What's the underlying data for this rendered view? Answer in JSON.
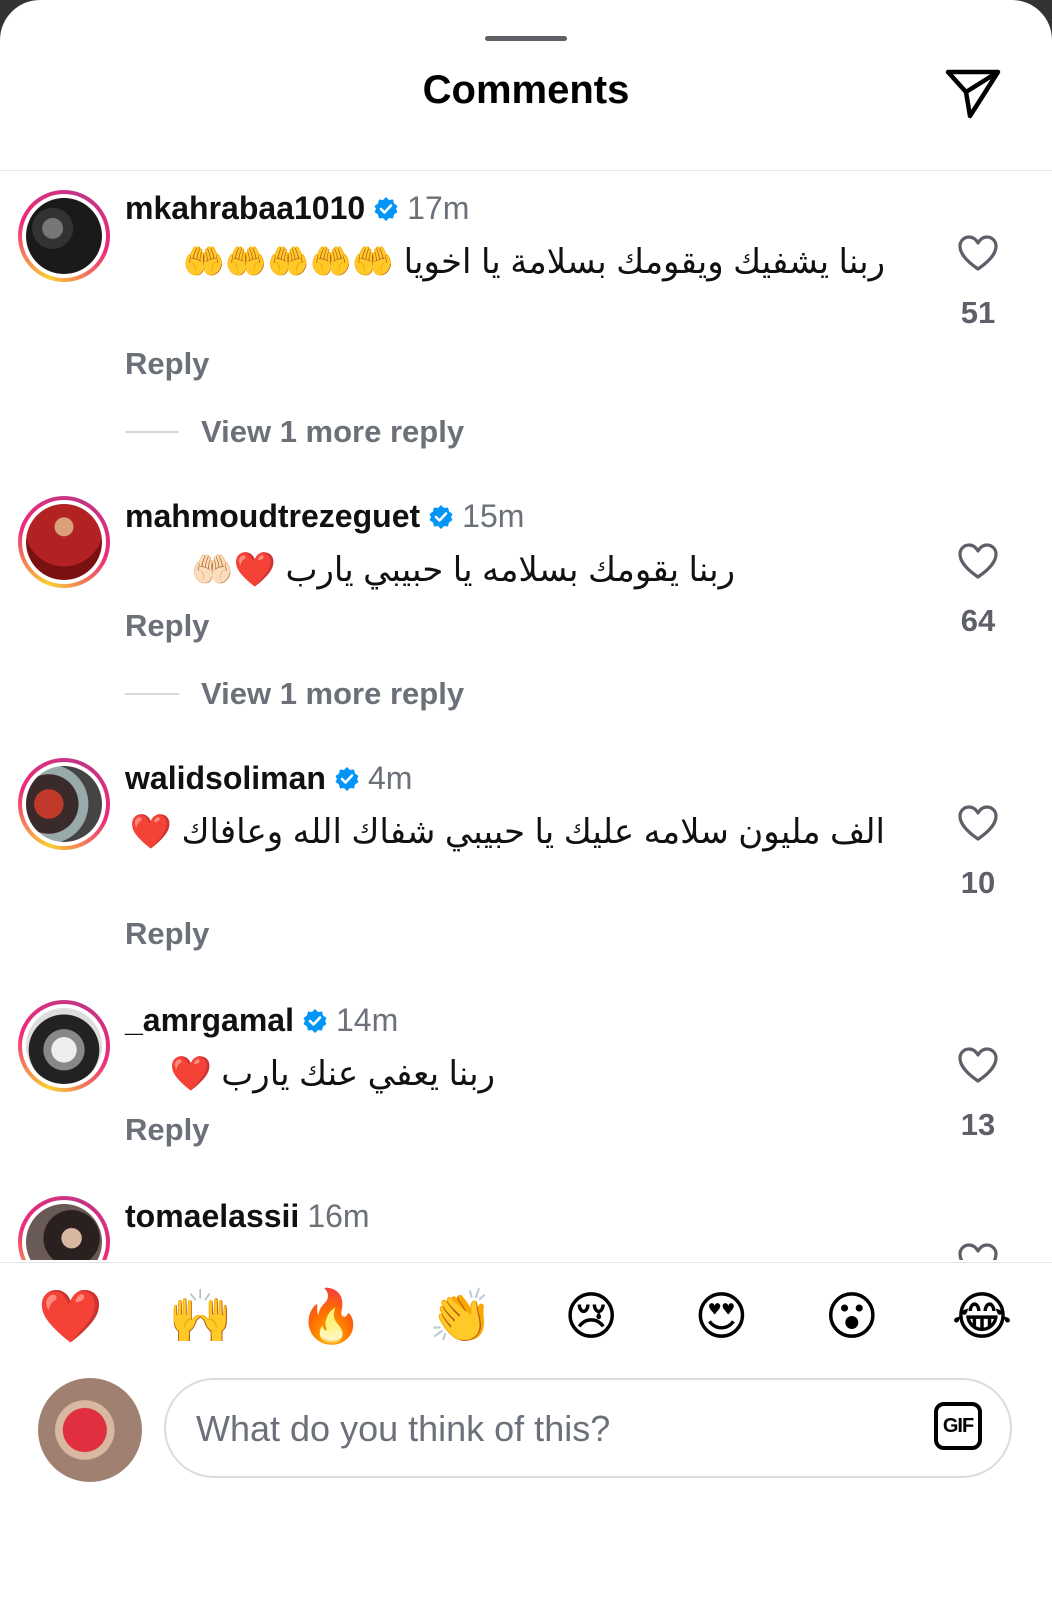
{
  "header": {
    "title": "Comments"
  },
  "comments": [
    {
      "username": "mkahrabaa1010",
      "verified": true,
      "time": "17m",
      "text": "ربنا يشفيك ويقومك بسلامة يا اخويا 🤲🤲🤲🤲🤲",
      "reply_label": "Reply",
      "view_more": "View 1 more reply",
      "likes": "51"
    },
    {
      "username": "mahmoudtrezeguet",
      "verified": true,
      "time": "15m",
      "text": "ربنا يقومك بسلامه يا حبيبي يارب ❤️🤲🏻",
      "reply_label": "Reply",
      "view_more": "View 1 more reply",
      "likes": "64"
    },
    {
      "username": "walidsoliman",
      "verified": true,
      "time": "4m",
      "text": "الف مليون سلامه عليك يا حبيبي شفاك الله وعافاك ❤️",
      "reply_label": "Reply",
      "likes": "10"
    },
    {
      "username": "_amrgamal",
      "verified": true,
      "time": "14m",
      "text": "ربنا يعفي عنك يارب ❤️",
      "reply_label": "Reply",
      "likes": "13"
    },
    {
      "username": "tomaelassii",
      "verified": false,
      "time": "16m"
    }
  ],
  "emoji_bar": [
    "❤️",
    "🙌",
    "🔥",
    "👏",
    "😢",
    "😍",
    "😮",
    "😂"
  ],
  "composer": {
    "placeholder": "What do you think of this?",
    "gif_label": "GIF"
  },
  "colors": {
    "verified_blue": "#0095f6",
    "secondary_text": "#6b7079",
    "primary_text": "#111111"
  }
}
